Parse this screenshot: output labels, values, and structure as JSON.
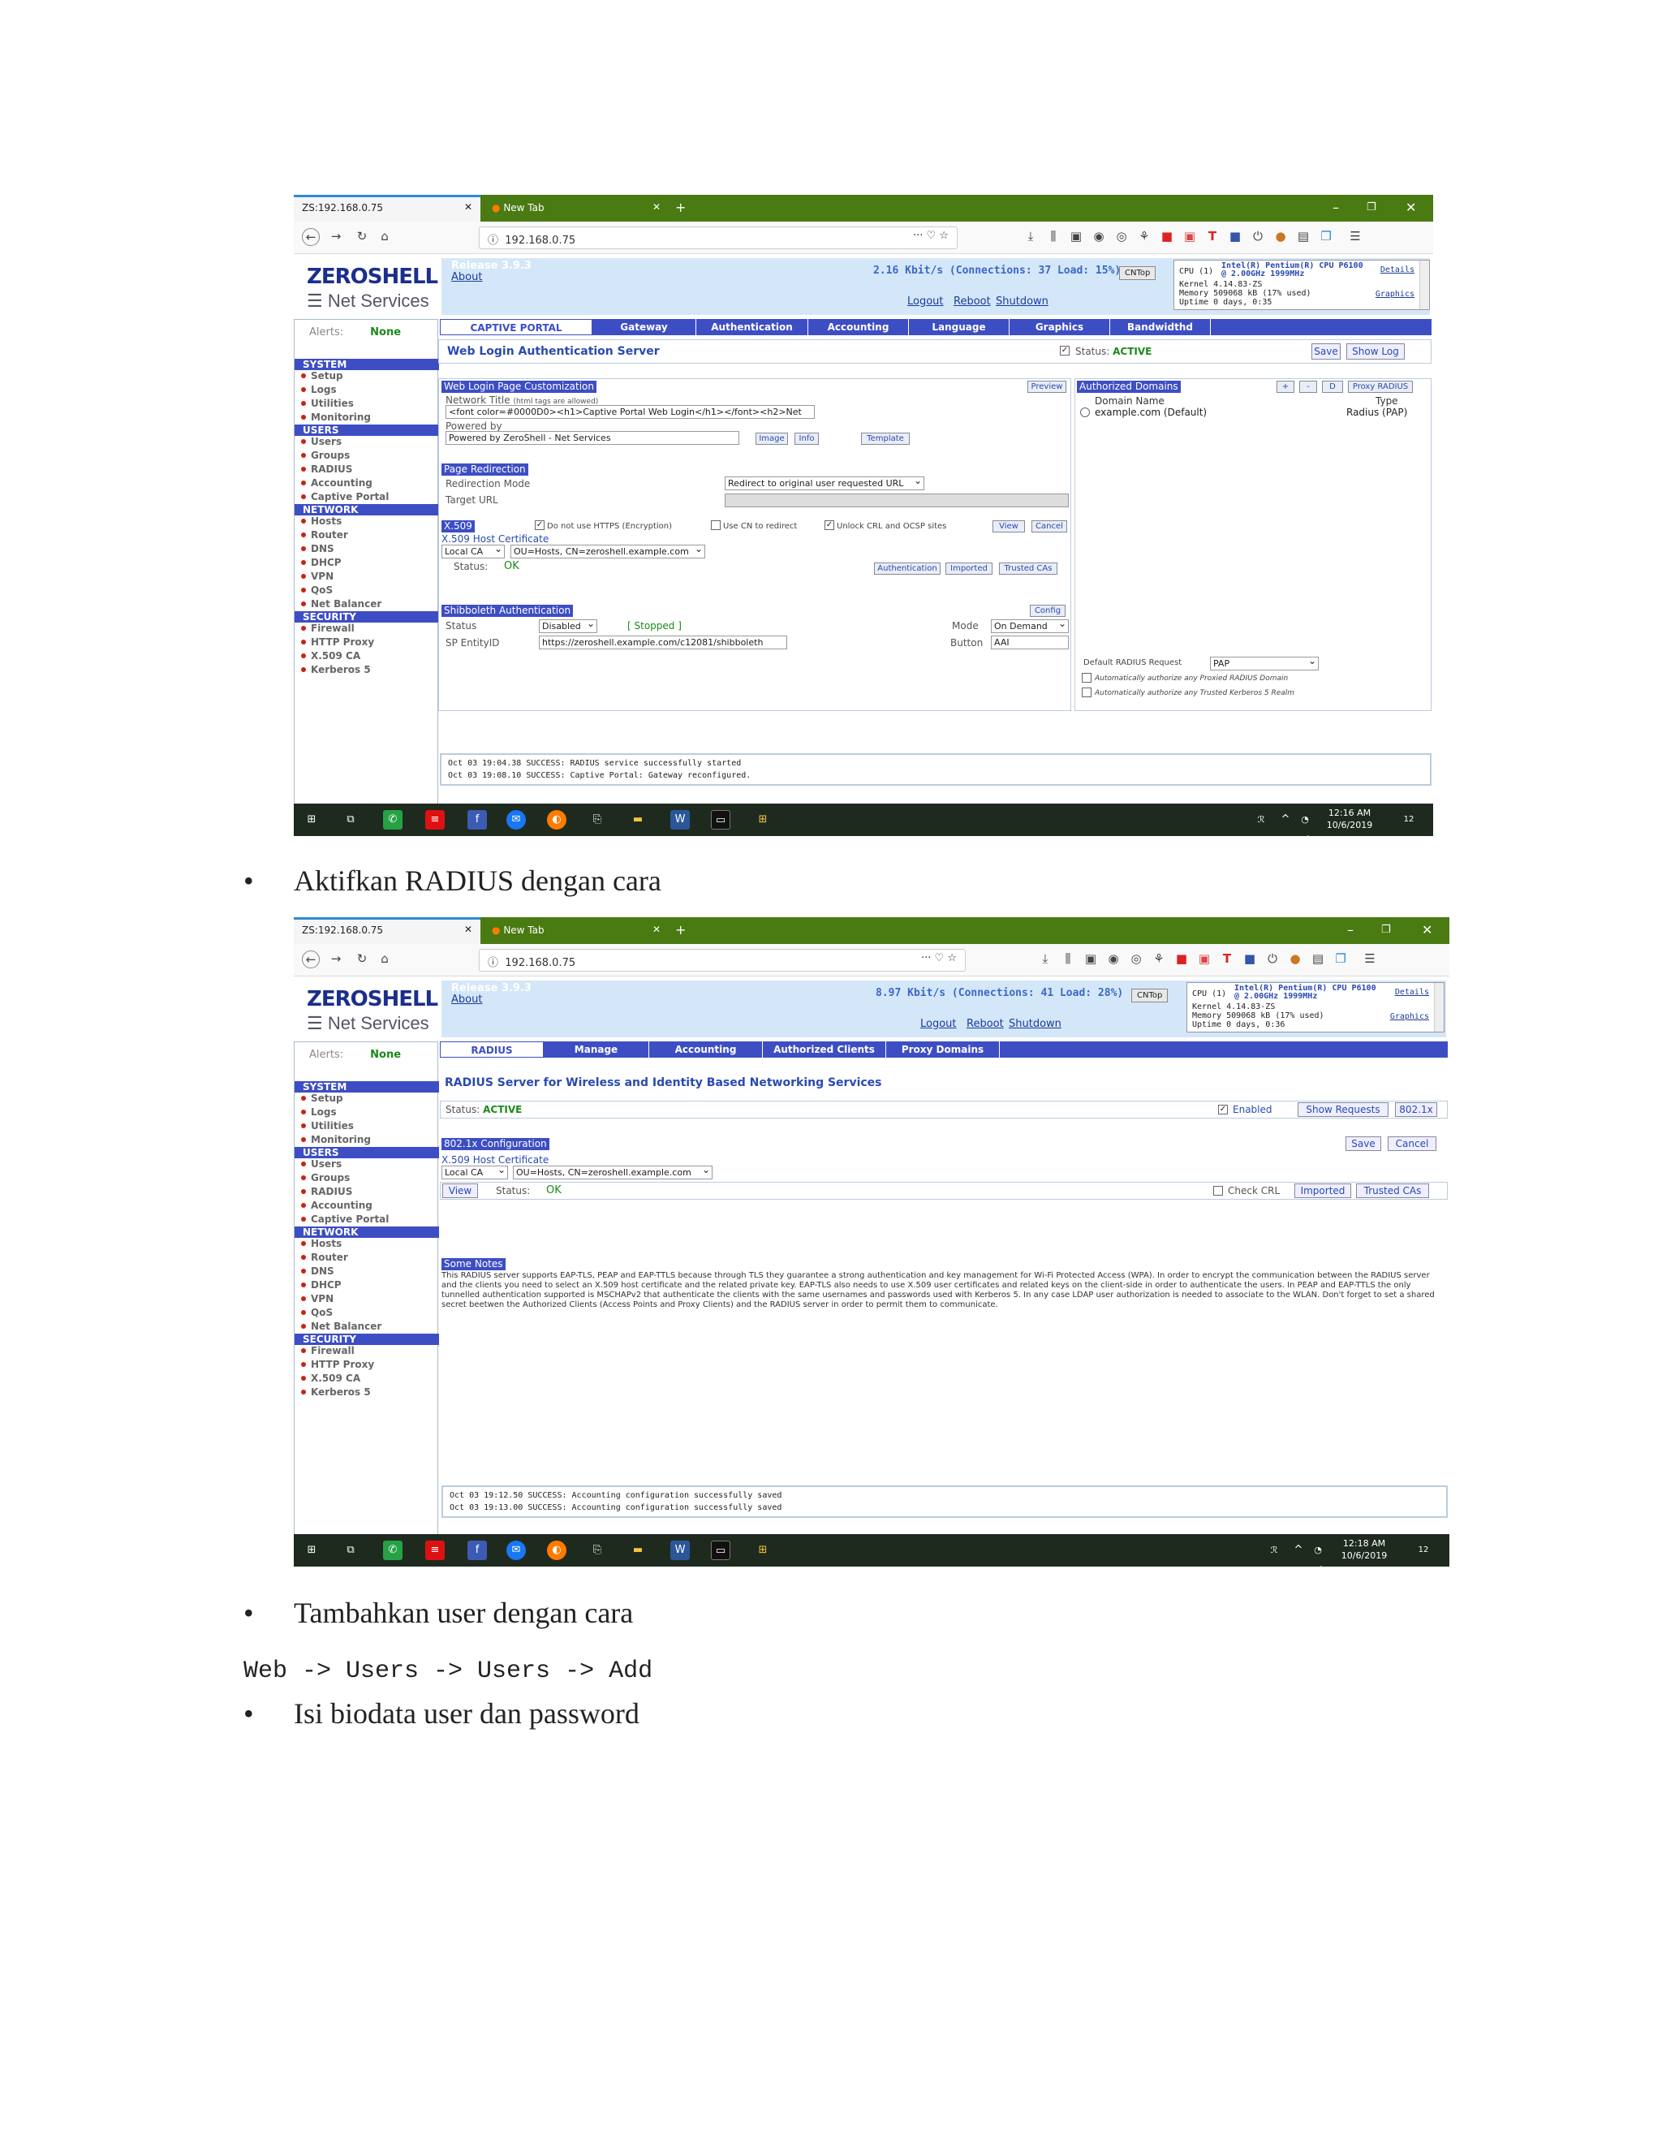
{
  "screenshot1": {
    "tab_title": "ZS:192.168.0.75",
    "tab2_title": "New Tab",
    "url": "192.168.0.75",
    "release": "Release 3.9.3",
    "about": "About",
    "traffic": "2.16 Kbit/s (Connections: 37 Load: 15%)",
    "cntop": "CNTop",
    "logout": "Logout",
    "reboot": "Reboot",
    "shutdown": "Shutdown",
    "cpu_label": "CPU (1)",
    "cpu_model": "Intel(R) Pentium(R) CPU P6100 @ 2.00GHz 1999MHz",
    "details": "Details",
    "graphics_link": "Graphics",
    "kernel": "Kernel   4.14.83-ZS",
    "memory": "Memory  509068 kB (17% used)",
    "uptime": "Uptime   0 days, 0:35",
    "alerts_label": "Alerts:",
    "alerts_value": "None",
    "tabs": [
      "CAPTIVE PORTAL",
      "Gateway",
      "Authentication",
      "Accounting",
      "Language",
      "Graphics",
      "Bandwidthd"
    ],
    "page_title": "Web Login Authentication Server",
    "status_label": "Status:",
    "status_value": "ACTIVE",
    "save": "Save",
    "show_log": "Show Log",
    "web_login_h": "Web Login Page Customization",
    "preview": "Preview",
    "network_title": "Network Title",
    "html_allowed": "(html tags are allowed)",
    "network_title_value": "<font color=#0000D0><h1>Captive Portal Web Login</h1></font><h2>Net",
    "powered_by": "Powered by",
    "powered_by_value": "Powered by ZeroShell - Net Services",
    "image_btn": "Image",
    "info_btn": "Info",
    "template_btn": "Template",
    "page_redirection_h": "Page Redirection",
    "redirection_mode": "Redirection Mode",
    "redirection_mode_value": "Redirect to original user requested URL",
    "target_url": "Target URL",
    "x509_h": "X.509",
    "no_https": "Do not use HTTPS (Encryption)",
    "use_cn": "Use CN to redirect",
    "unlock_crl": "Unlock CRL and OCSP sites",
    "view": "View",
    "cancel": "Cancel",
    "x509_host_cert": "X.509 Host Certificate",
    "local_ca": "Local CA",
    "ou_value": "OU=Hosts, CN=zeroshell.example.com",
    "status2": "Status:",
    "ok": "OK",
    "authentication_btn": "Authentication",
    "imported_btn": "Imported",
    "trusted_cas_btn": "Trusted CAs",
    "shib_h": "Shibboleth Authentication",
    "config_btn": "Config",
    "shib_status": "Status",
    "shib_disabled": "Disabled",
    "shib_stopped": "[ Stopped ]",
    "mode": "Mode",
    "on_demand": "On Demand",
    "sp_entity": "SP EntityID",
    "sp_entity_value": "https://zeroshell.example.com/c12081/shibboleth",
    "button_label": "Button",
    "button_value": "AAI",
    "auth_domains_h": "Authorized Domains",
    "plus": "+",
    "minus": "-",
    "d": "D",
    "proxy_radius": "Proxy RADIUS",
    "domain_name": "Domain Name",
    "type": "Type",
    "domain_row": "example.com (Default)",
    "domain_type": "Radius (PAP)",
    "default_radius_req": "Default RADIUS Request",
    "pap": "PAP",
    "auto_proxied": "Automatically authorize any Proxied RADIUS Domain",
    "auto_kerberos": "Automatically authorize any Trusted Kerberos 5 Realm",
    "log1": "Oct 03 19:04.38 SUCCESS: RADIUS service successfully started",
    "log2": "Oct 03 19:08.10 SUCCESS: Captive Portal: Gateway reconfigured.",
    "clock_time": "12:16 AM",
    "clock_date": "10/6/2019",
    "notif": "12"
  },
  "sidebar": {
    "system": "SYSTEM",
    "system_items": [
      "Setup",
      "Logs",
      "Utilities",
      "Monitoring"
    ],
    "users": "USERS",
    "users_items": [
      "Users",
      "Groups",
      "RADIUS",
      "Accounting",
      "Captive Portal"
    ],
    "network": "NETWORK",
    "network_items": [
      "Hosts",
      "Router",
      "DNS",
      "DHCP",
      "VPN",
      "QoS",
      "Net Balancer"
    ],
    "security": "SECURITY",
    "security_items": [
      "Firewall",
      "HTTP Proxy",
      "X.509 CA",
      "Kerberos 5"
    ]
  },
  "logo": {
    "main": "ZEROSHELL",
    "sub": "Net Services"
  },
  "bullet1": "Aktifkan RADIUS dengan cara",
  "screenshot2": {
    "tab_title": "ZS:192.168.0.75",
    "tab2_title": "New Tab",
    "url": "192.168.0.75",
    "release": "Release 3.9.3",
    "about": "About",
    "traffic": "8.97 Kbit/s (Connections: 41 Load: 28%)",
    "cntop": "CNTop",
    "logout": "Logout",
    "reboot": "Reboot",
    "shutdown": "Shutdown",
    "cpu_label": "CPU (1)",
    "cpu_model": "Intel(R) Pentium(R) CPU P6100 @ 2.00GHz 1999MHz",
    "details": "Details",
    "graphics_link": "Graphics",
    "kernel": "Kernel   4.14.83-ZS",
    "memory": "Memory  509068 kB (17% used)",
    "uptime": "Uptime   0 days, 0:36",
    "alerts_label": "Alerts:",
    "alerts_value": "None",
    "tabs": [
      "RADIUS",
      "Manage",
      "Accounting",
      "Authorized Clients",
      "Proxy Domains"
    ],
    "page_title": "RADIUS Server for Wireless and Identity Based Networking Services",
    "status_label": "Status:",
    "status_value": "ACTIVE",
    "enabled": "Enabled",
    "show_requests": "Show Requests",
    "dot1x": "802.1x",
    "config_h": "802.1x Configuration",
    "save": "Save",
    "cancel": "Cancel",
    "x509_host_cert": "X.509 Host Certificate",
    "local_ca": "Local CA",
    "ou_value": "OU=Hosts, CN=zeroshell.example.com",
    "view": "View",
    "status2": "Status:",
    "ok": "OK",
    "check_crl": "Check CRL",
    "imported": "Imported",
    "trusted_cas": "Trusted CAs",
    "notes_h": "Some Notes",
    "notes_text": "This RADIUS server supports EAP-TLS, PEAP and EAP-TTLS because through TLS they guarantee a strong authentication and key management for Wi-Fi Protected Access (WPA). In order to encrypt the communication between the RADIUS server and the clients you need to select an X.509 host certificate and the related private key. EAP-TLS also needs to use X.509 user certificates and related keys on the client-side in order to authenticate the users. In PEAP and EAP-TTLS the only tunnelled authentication supported is MSCHAPv2 that authenticate the clients with the same usernames and passwords used with Kerberos 5. In any case LDAP user authorization is needed to associate to the WLAN. Don't forget to set a shared secret beetwen the Authorized Clients (Access Points and Proxy Clients) and the RADIUS server in order to permit them to communicate.",
    "log1": "Oct 03 19:12.50 SUCCESS: Accounting configuration successfully saved",
    "log2": "Oct 03 19:13.00 SUCCESS: Accounting configuration successfully saved",
    "clock_time": "12:18 AM",
    "clock_date": "10/6/2019",
    "notif": "12"
  },
  "bullet2": "Tambahkan user dengan cara",
  "code_line": "Web -> Users -> Users -> Add",
  "bullet3": "Isi biodata user dan password",
  "colors": {
    "accent": "#3d4ec4",
    "header_bg": "#d4e7f8",
    "tab_bar": "#4a7a12",
    "taskbar": "#1f2a1f",
    "ok": "#1a8a1a"
  }
}
